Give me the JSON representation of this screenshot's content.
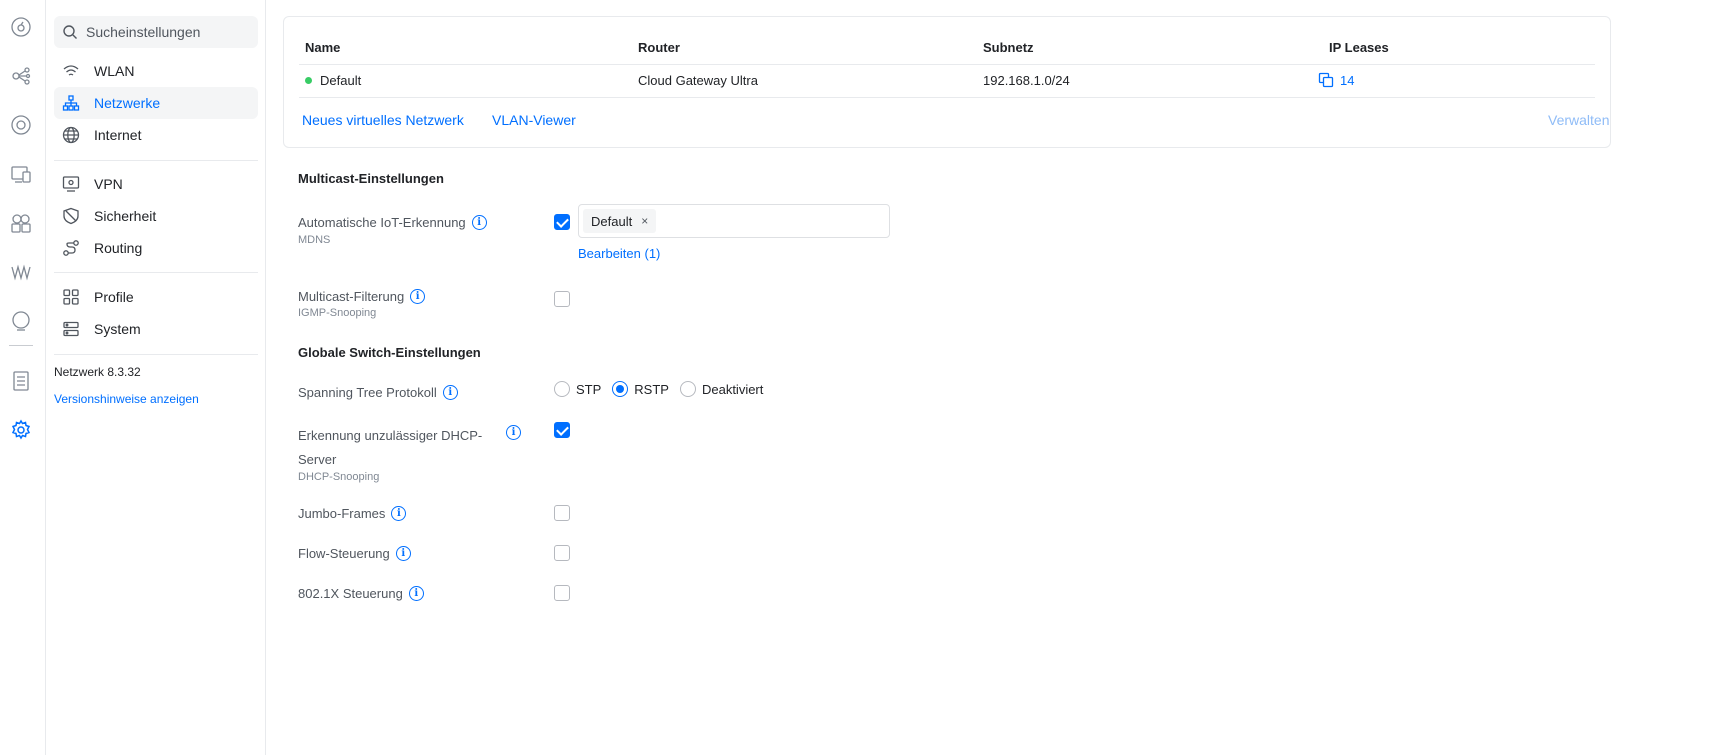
{
  "rail": {
    "icons": [
      "dashboard-icon",
      "topology-icon",
      "devices-icon",
      "clients-icon",
      "insights-icon",
      "wifiman-icon",
      "radar-icon",
      "logs-icon",
      "settings-icon"
    ]
  },
  "sidebar": {
    "search_placeholder": "Sucheinstellungen",
    "items": [
      {
        "label": "WLAN",
        "icon": "wifi-icon"
      },
      {
        "label": "Netzwerke",
        "icon": "network-icon",
        "active": true
      },
      {
        "label": "Internet",
        "icon": "globe-icon"
      },
      {
        "label": "VPN",
        "icon": "vpn-icon"
      },
      {
        "label": "Sicherheit",
        "icon": "shield-icon"
      },
      {
        "label": "Routing",
        "icon": "routing-icon"
      },
      {
        "label": "Profile",
        "icon": "profile-icon"
      },
      {
        "label": "System",
        "icon": "system-icon"
      }
    ],
    "version": "Netzwerk 8.3.32",
    "release_notes": "Versionshinweise anzeigen"
  },
  "networks": {
    "columns": [
      "Name",
      "Router",
      "Subnetz",
      "IP Leases"
    ],
    "rows": [
      {
        "name": "Default",
        "router": "Cloud Gateway Ultra",
        "subnet": "192.168.1.0/24",
        "leases": "14",
        "status_color": "#38cc65"
      }
    ],
    "new_network": "Neues virtuelles Netzwerk",
    "vlan_viewer": "VLAN-Viewer",
    "manage": "Verwalten"
  },
  "multicast": {
    "title": "Multicast-Einstellungen",
    "iot": {
      "label": "Automatische IoT-Erkennung",
      "sub": "MDNS",
      "checked": true,
      "tags": [
        "Default"
      ],
      "edit": "Bearbeiten (1)"
    },
    "filter": {
      "label": "Multicast-Filterung",
      "sub": "IGMP-Snooping",
      "checked": false
    }
  },
  "switch": {
    "title": "Globale Switch-Einstellungen",
    "stp": {
      "label": "Spanning Tree Protokoll",
      "options": [
        "STP",
        "RSTP",
        "Deaktiviert"
      ],
      "selected": "RSTP"
    },
    "dhcp": {
      "label_line1": "Erkennung unzulässiger DHCP-",
      "label_line2": "Server",
      "sub": "DHCP-Snooping",
      "checked": true
    },
    "jumbo": {
      "label": "Jumbo-Frames",
      "checked": false
    },
    "flow": {
      "label": "Flow-Steuerung",
      "checked": false
    },
    "dot1x": {
      "label": "802.1X Steuerung",
      "checked": false
    }
  },
  "colors": {
    "accent": "#006fff",
    "status_ok": "#38cc65"
  }
}
